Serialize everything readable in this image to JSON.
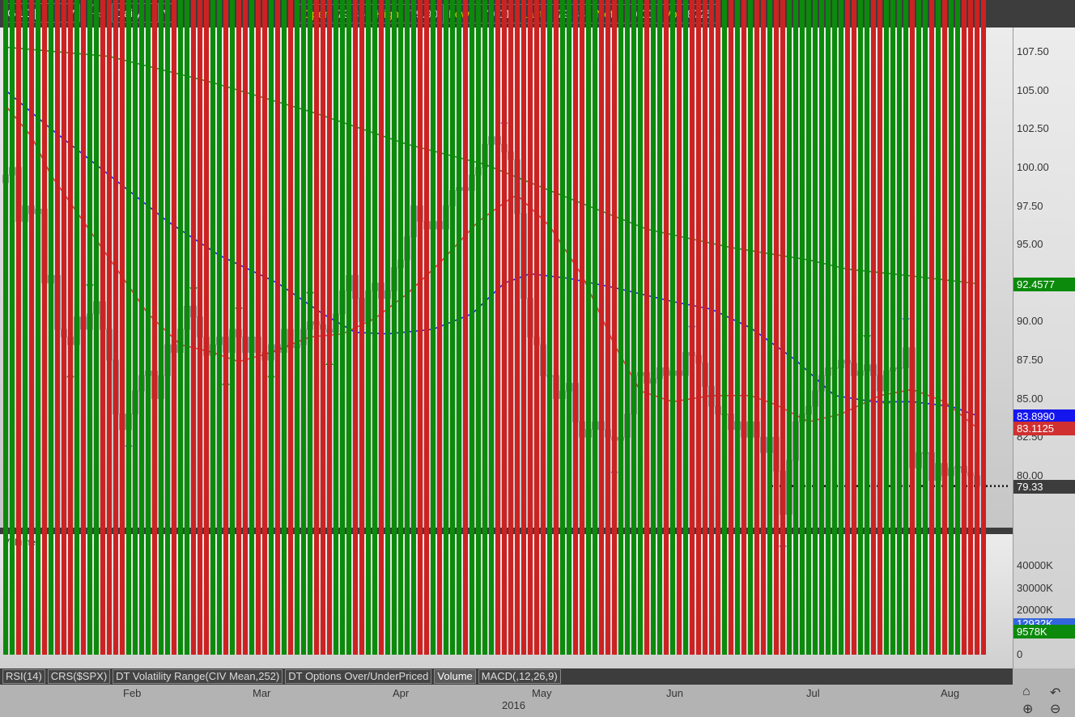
{
  "toolbar": {
    "symbol": "GILD",
    "period": "Daily",
    "quote": [
      {
        "label": "Open",
        "value": "79.86"
      },
      {
        "label": "High",
        "value": "79.90"
      },
      {
        "label": "Low",
        "value": "79.01"
      },
      {
        "label": "Last",
        "value": "79.33"
      },
      {
        "label": "Net",
        "value": "0.00"
      },
      {
        "label": "Vol",
        "value": "8725"
      }
    ]
  },
  "price_axis": [
    "107.50",
    "105.00",
    "102.50",
    "100.00",
    "97.50",
    "95.00",
    "92.50",
    "90.00",
    "87.50",
    "85.00",
    "82.50",
    "80.00"
  ],
  "price_tags": {
    "ma200": "92.4577",
    "ma50": "83.8990",
    "ma20": "83.1125",
    "last": "79.33"
  },
  "volume_pane": {
    "title": "Volume",
    "ticks": [
      "40000K",
      "30000K",
      "20000K",
      "0"
    ],
    "avg_tag": "12932K",
    "last_tag": "9578K"
  },
  "tabs": [
    "RSI(14)",
    "CRS($SPX)",
    "DT Volatility Range(CIV Mean,252)",
    "DT Options Over/UnderPriced",
    "Volume",
    "MACD(,12,26,9)"
  ],
  "active_tab": "Volume",
  "months": [
    "Feb",
    "Mar",
    "Apr",
    "May",
    "Jun",
    "Jul",
    "Aug"
  ],
  "year": "2016",
  "colors": {
    "up": "#ffffff",
    "down": "#cc2222",
    "ma20": "#dd3333",
    "ma50": "#1a1aee",
    "ma200": "#1e8c1e",
    "vol_up": "#0b8a0b",
    "vol_down": "#cc2222",
    "vol_avg": "#3366dd"
  },
  "chart_data": {
    "type": "candlestick",
    "symbol": "GILD",
    "ylim": [
      77,
      108
    ],
    "first_open": 99.0,
    "closes": [
      99.5,
      100,
      96.5,
      97.5,
      97,
      97.3,
      92.5,
      93,
      89.5,
      89,
      88.5,
      90.3,
      89.5,
      90.5,
      91.3,
      89.5,
      87.5,
      84,
      83,
      84,
      85.5,
      86.5,
      86.8,
      85,
      86.5,
      88.5,
      88,
      89.5,
      91,
      90.3,
      89,
      87.8,
      88.5,
      89,
      88,
      89.5,
      89,
      88,
      89,
      88,
      87.5,
      88.5,
      88,
      89.5,
      88.3,
      88.5,
      89.5,
      90,
      89.8,
      89.5,
      89.3,
      90.5,
      92,
      93,
      91.5,
      90,
      92,
      92.5,
      91.5,
      92,
      93.5,
      94,
      95.5,
      97.5,
      96.5,
      96,
      96.5,
      96,
      97.5,
      98.5,
      98.7,
      98.5,
      99.5,
      100,
      101.5,
      102,
      101.5,
      101,
      100.5,
      97,
      91.5,
      89,
      88.5,
      86.5,
      86.5,
      85,
      85.5,
      86,
      83.5,
      82.5,
      83,
      83.5,
      83,
      82.5,
      82.3,
      82.5,
      84,
      86.5,
      86.7,
      86,
      86.3,
      87,
      86.5,
      86.8,
      86.5,
      88,
      87.8,
      87.3,
      85.8,
      84.5,
      84,
      84,
      83,
      83.5,
      82.5,
      83.5,
      82.5,
      81.5,
      82.5,
      80.3,
      77.5,
      81,
      83.5,
      84,
      84.5,
      85.5,
      86.5,
      87,
      87,
      87.5,
      87.3,
      86.5,
      86.8,
      87.2,
      86.5,
      85.5,
      86.8,
      87,
      87,
      88.3,
      80.5,
      81.5,
      81.5,
      79.7,
      80.8,
      80,
      80.5,
      80.6,
      80.2,
      80,
      79.33
    ],
    "volumes_k": [
      12000,
      13000,
      12500,
      12000,
      11000,
      13000,
      15000,
      16000,
      13500,
      17500,
      11000,
      13000,
      12000,
      14000,
      11500,
      10000,
      12000,
      37500,
      15000,
      16000,
      12000,
      25000,
      15000,
      14500,
      15000,
      13000,
      12000,
      14000,
      13000,
      14500,
      22000,
      12500,
      14000,
      12000,
      11500,
      11000,
      12500,
      13000,
      13000,
      11500,
      12000,
      21500,
      11500,
      13000,
      12000,
      12000,
      11000,
      10500,
      11000,
      11500,
      12000,
      13500,
      16000,
      12000,
      11500,
      13000,
      12500,
      12000,
      11500,
      12000,
      13000,
      11000,
      11500,
      12000,
      13500,
      12000,
      11000,
      10500,
      11000,
      10000,
      11000,
      10500,
      10000,
      11000,
      10500,
      11000,
      11500,
      10000,
      10500,
      12500,
      33500,
      14000,
      12000,
      10500,
      11000,
      10000,
      11000,
      10500,
      9500,
      10000,
      9500,
      10000,
      9000,
      10000,
      9500,
      10000,
      9000,
      10500,
      14000,
      11000,
      9500,
      9000,
      10000,
      9500,
      10000,
      9000,
      9000,
      9500,
      9000,
      10000,
      9500,
      9000,
      9000,
      10000,
      9500,
      9000,
      16000,
      10000,
      11000,
      10000,
      9500,
      12500,
      15000,
      12500,
      11000,
      10000,
      10500,
      9500,
      10000,
      9500,
      10000,
      9500,
      10500,
      12000,
      9500,
      10000,
      9500,
      11500,
      12000,
      10000,
      16000,
      47500,
      15000,
      12500,
      19500,
      11500,
      17000,
      13000,
      11000,
      10500,
      10000,
      9578
    ],
    "vol_avg_k": [
      12500,
      12800,
      13500,
      14000,
      15500,
      16000,
      15000,
      14200,
      14200,
      14000,
      13500,
      13200,
      13200,
      13000,
      12800,
      12500,
      12500,
      12800,
      13000,
      13000,
      12500,
      12000,
      11800,
      11500,
      11000,
      10500,
      10300,
      10200,
      10300,
      10300,
      10200,
      10300,
      10300,
      10300,
      10300,
      10300,
      11000,
      11200,
      11000,
      11300,
      11500,
      11800,
      12500,
      12700,
      12900,
      12932
    ],
    "ma20": [
      [
        0,
        104
      ],
      [
        4,
        102
      ],
      [
        7,
        99.5
      ],
      [
        12,
        96.5
      ],
      [
        17,
        93.5
      ],
      [
        22,
        90.5
      ],
      [
        27,
        88.5
      ],
      [
        32,
        88
      ],
      [
        36,
        87.4
      ],
      [
        41,
        88
      ],
      [
        47,
        89
      ],
      [
        52,
        89.2
      ],
      [
        57,
        90.2
      ],
      [
        62,
        91.8
      ],
      [
        67,
        93.8
      ],
      [
        73,
        96.5
      ],
      [
        78,
        98
      ],
      [
        79,
        98.2
      ],
      [
        84,
        96.2
      ],
      [
        89,
        93
      ],
      [
        94,
        88.5
      ],
      [
        98,
        85.5
      ],
      [
        103,
        84.8
      ],
      [
        109,
        85.2
      ],
      [
        115,
        85.2
      ],
      [
        119,
        84.6
      ],
      [
        124,
        83.5
      ],
      [
        129,
        84
      ],
      [
        135,
        85.2
      ],
      [
        140,
        85.6
      ],
      [
        145,
        84.8
      ],
      [
        150,
        83.1
      ]
    ],
    "ma50": [
      [
        0,
        105
      ],
      [
        7,
        102.5
      ],
      [
        16,
        99.5
      ],
      [
        25,
        96.5
      ],
      [
        33,
        94.3
      ],
      [
        42,
        92.5
      ],
      [
        49,
        90.5
      ],
      [
        54,
        89.3
      ],
      [
        59,
        89.2
      ],
      [
        66,
        89.5
      ],
      [
        72,
        90.5
      ],
      [
        77,
        92.5
      ],
      [
        81,
        93.1
      ],
      [
        87,
        92.8
      ],
      [
        94,
        92.2
      ],
      [
        103,
        91.3
      ],
      [
        109,
        90.8
      ],
      [
        115,
        89.6
      ],
      [
        122,
        87.5
      ],
      [
        128,
        85.2
      ],
      [
        134,
        84.8
      ],
      [
        140,
        84.8
      ],
      [
        146,
        84.5
      ],
      [
        150,
        83.9
      ]
    ],
    "ma200": [
      [
        0,
        107.8
      ],
      [
        16,
        107.2
      ],
      [
        32,
        105.5
      ],
      [
        48,
        103.5
      ],
      [
        62,
        101.5
      ],
      [
        74,
        100.2
      ],
      [
        87,
        98
      ],
      [
        99,
        96
      ],
      [
        112,
        94.8
      ],
      [
        124,
        94
      ],
      [
        130,
        93.4
      ],
      [
        139,
        93
      ],
      [
        150,
        92.46
      ]
    ],
    "markers": [
      [
        10,
        "green",
        "below"
      ],
      [
        13,
        "green",
        "above"
      ],
      [
        19,
        "blue",
        "below"
      ],
      [
        29,
        "green",
        "above"
      ],
      [
        34,
        "green",
        "below"
      ],
      [
        36,
        "green",
        "above"
      ],
      [
        41,
        "green",
        "below"
      ],
      [
        47,
        "green",
        "above"
      ],
      [
        50,
        "green",
        "below"
      ],
      [
        77,
        "blue",
        "above"
      ],
      [
        94,
        "blue",
        "below"
      ],
      [
        106,
        "blue",
        "above"
      ],
      [
        120,
        "blue",
        "below"
      ],
      [
        133,
        "green",
        "above"
      ],
      [
        136,
        "green",
        "below"
      ],
      [
        139,
        "blue",
        "above"
      ]
    ],
    "support_level": 79.33
  }
}
